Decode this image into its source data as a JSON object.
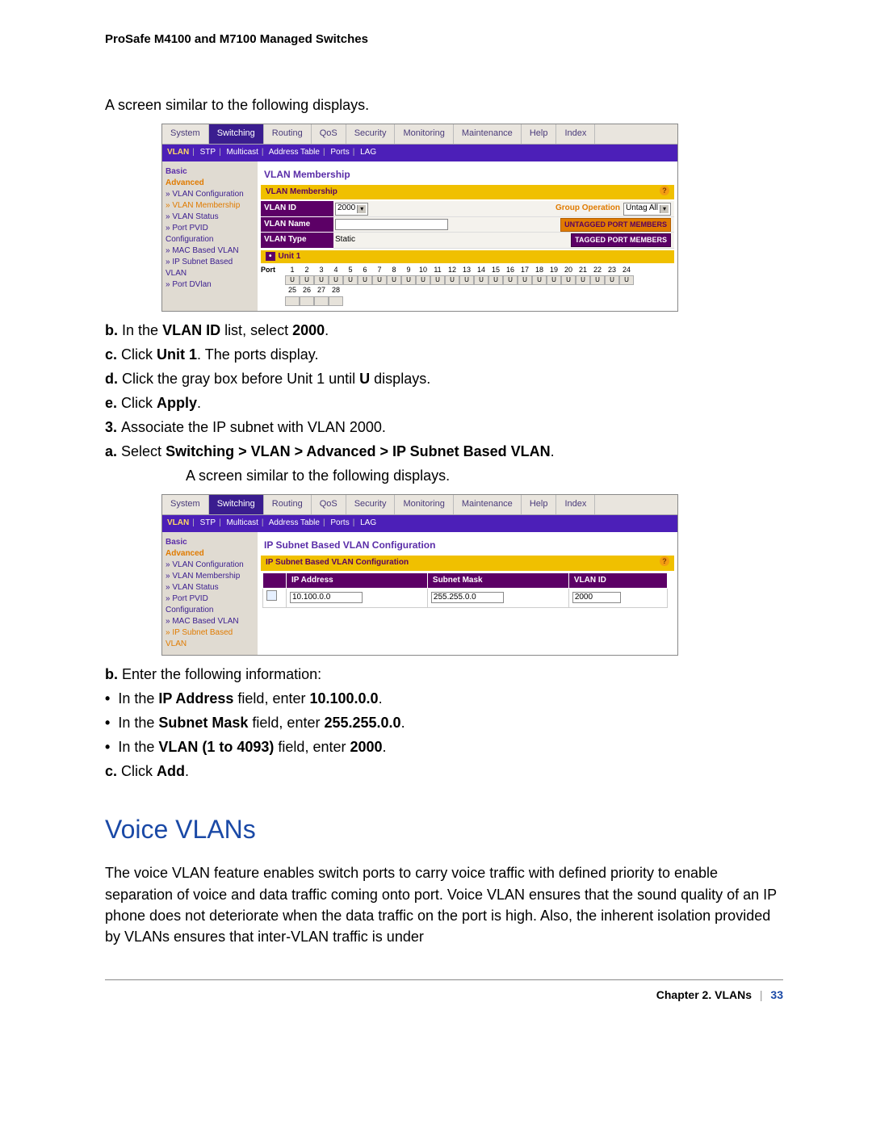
{
  "header": "ProSafe M4100 and M7100 Managed Switches",
  "intro1": "A screen similar to the following displays.",
  "scr1": {
    "tabs": {
      "t0": "System",
      "t1": "Switching",
      "t2": "Routing",
      "t3": "QoS",
      "t4": "Security",
      "t5": "Monitoring",
      "t6": "Maintenance",
      "t7": "Help",
      "t8": "Index"
    },
    "subnav": {
      "s0": "VLAN",
      "s1": "STP",
      "s2": "Multicast",
      "s3": "Address Table",
      "s4": "Ports",
      "s5": "LAG"
    },
    "side": {
      "basic": "Basic",
      "advanced": "Advanced",
      "i0": "» VLAN Configuration",
      "i1": "» VLAN Membership",
      "i2": "» VLAN Status",
      "i3": "» Port PVID Configuration",
      "i4": "» MAC Based VLAN",
      "i5": "» IP Subnet Based VLAN",
      "i6": "» Port DVlan"
    },
    "title": "VLAN Membership",
    "bar": "VLAN Membership",
    "row_vlanid": "VLAN ID",
    "val_vlanid": "2000",
    "row_vlanname": "VLAN Name",
    "row_vlantype": "VLAN Type",
    "val_vlantype": "Static",
    "group_op": "Group Operation",
    "untag_all": "Untag All",
    "btn_untag": "UNTAGGED PORT MEMBERS",
    "btn_tag": "TAGGED PORT MEMBERS",
    "unit": "Unit 1",
    "port_label": "Port",
    "ports_row1": [
      "1",
      "2",
      "3",
      "4",
      "5",
      "6",
      "7",
      "8",
      "9",
      "10",
      "11",
      "12",
      "13",
      "14",
      "15",
      "16",
      "17",
      "18",
      "19",
      "20",
      "21",
      "22",
      "23",
      "24"
    ],
    "ports_row2": [
      "25",
      "26",
      "27",
      "28"
    ]
  },
  "steps": {
    "b1_pre": "In the ",
    "b1_b": "VLAN ID",
    "b1_mid": " list, select ",
    "b1_v": "2000",
    "b1_suf": ".",
    "c1_pre": "Click ",
    "c1_b": "Unit 1",
    "c1_suf": ". The ports display.",
    "d1_pre": "Click the gray box before Unit 1 until ",
    "d1_b": "U",
    "d1_suf": " displays.",
    "e1_pre": "Click ",
    "e1_b": "Apply",
    "e1_suf": ".",
    "s3": "Associate the IP subnet with VLAN 2000.",
    "a2_pre": "Select ",
    "a2_b": "Switching > VLAN > Advanced > IP Subnet Based VLAN",
    "a2_suf": ".",
    "a2_after": "A screen similar to the following displays.",
    "b2": "Enter the following information:",
    "b2a_pre": "In the ",
    "b2a_b": "IP Address",
    "b2a_mid": " field, enter ",
    "b2a_v": "10.100.0.0",
    "b2a_suf": ".",
    "b2b_pre": "In the ",
    "b2b_b": "Subnet Mask",
    "b2b_mid": " field, enter ",
    "b2b_v": "255.255.0.0",
    "b2b_suf": ".",
    "b2c_pre": "In the ",
    "b2c_b": "VLAN (1 to 4093)",
    "b2c_mid": " field, enter ",
    "b2c_v": "2000",
    "b2c_suf": ".",
    "c2_pre": "Click ",
    "c2_b": "Add",
    "c2_suf": "."
  },
  "scr2": {
    "title": "IP Subnet Based VLAN Configuration",
    "bar": "IP Subnet Based VLAN Configuration",
    "col_ip": "IP Address",
    "col_mask": "Subnet Mask",
    "col_vid": "VLAN ID",
    "val_ip": "10.100.0.0",
    "val_mask": "255.255.0.0",
    "val_vid": "2000",
    "side": {
      "basic": "Basic",
      "advanced": "Advanced",
      "i0": "» VLAN Configuration",
      "i1": "» VLAN Membership",
      "i2": "» VLAN Status",
      "i3": "» Port PVID Configuration",
      "i4": "» MAC Based VLAN",
      "i5": "» IP Subnet Based VLAN"
    }
  },
  "section": "Voice VLANs",
  "section_body": "The voice VLAN feature enables switch ports to carry voice traffic with defined priority to enable separation of voice and data traffic coming onto port. Voice VLAN ensures that the sound quality of an IP phone does not deteriorate when the data traffic on the port is high. Also, the inherent isolation provided by VLANs ensures that inter-VLAN traffic is under",
  "footer": {
    "chapter": "Chapter 2.  VLANs",
    "page": "33"
  }
}
